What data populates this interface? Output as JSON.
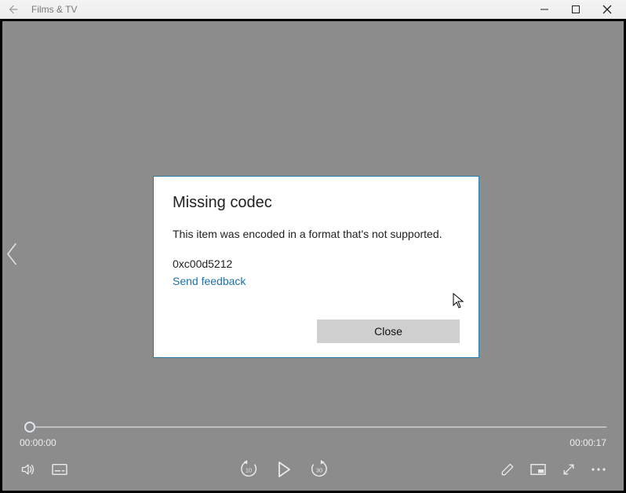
{
  "window": {
    "app_title": "Films & TV"
  },
  "dialog": {
    "title": "Missing codec",
    "message": "This item was encoded in a format that's not supported.",
    "error_code": "0xc00d5212",
    "feedback_link": "Send feedback",
    "close_label": "Close"
  },
  "player": {
    "current_time": "00:00:00",
    "total_time": "00:00:17",
    "skip_back_seconds": "10",
    "skip_forward_seconds": "30"
  }
}
